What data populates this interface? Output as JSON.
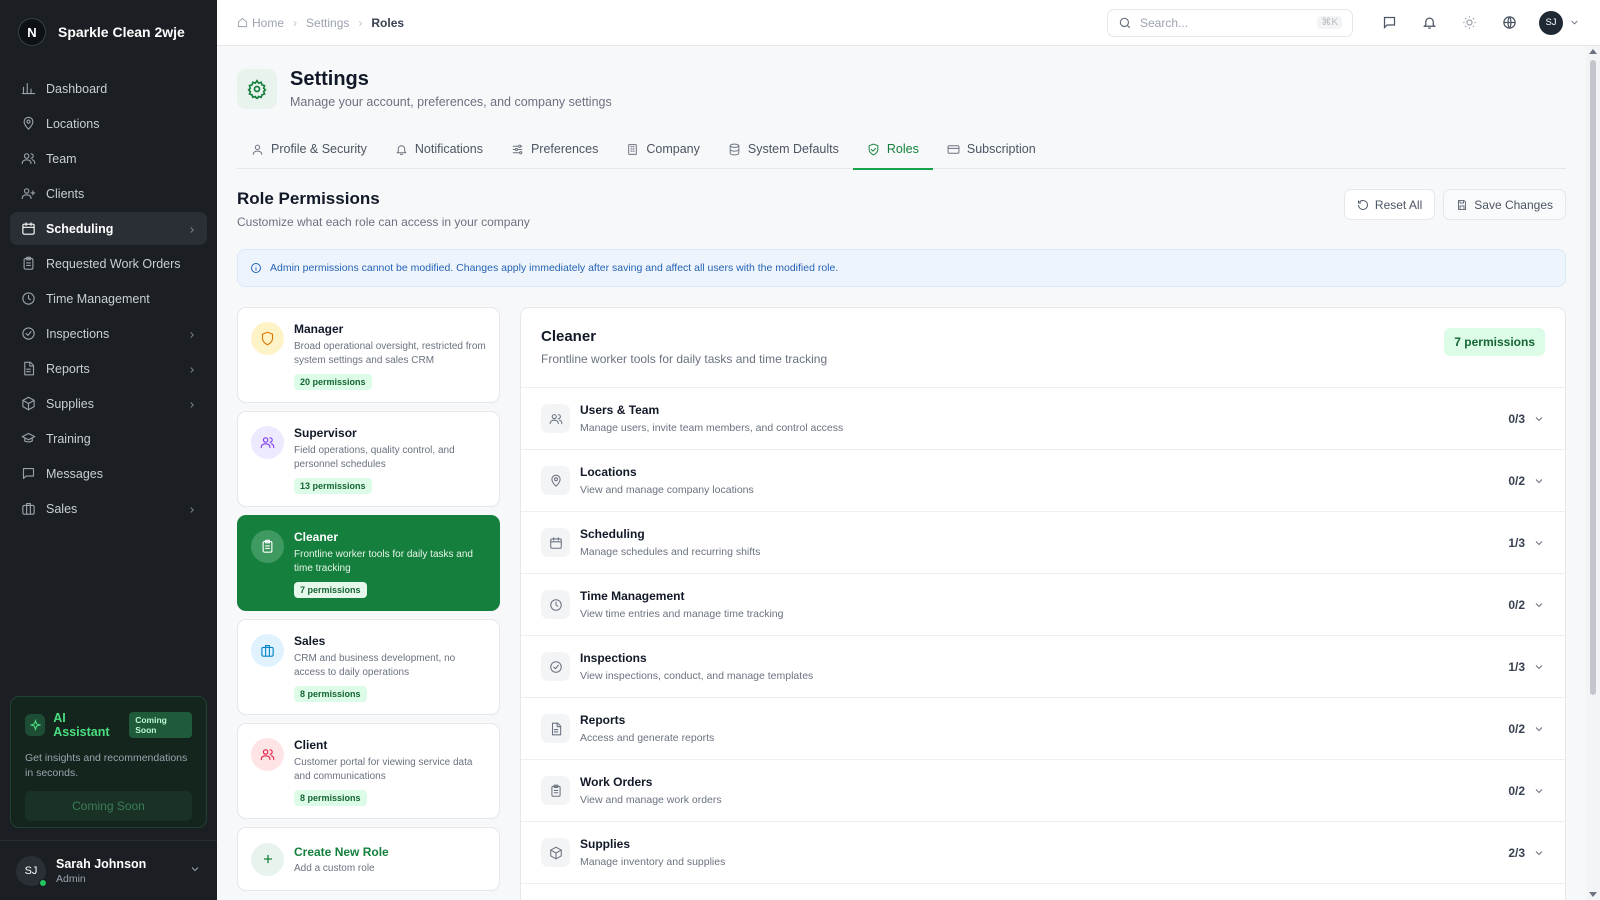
{
  "app": {
    "logo_letter": "N",
    "name": "Sparkle Clean 2wje"
  },
  "sidebar": {
    "items": [
      {
        "label": "Dashboard",
        "icon": "chart-icon"
      },
      {
        "label": "Locations",
        "icon": "map-pin-icon"
      },
      {
        "label": "Team",
        "icon": "users-icon"
      },
      {
        "label": "Clients",
        "icon": "user-plus-icon"
      },
      {
        "label": "Scheduling",
        "icon": "calendar-icon",
        "active": true,
        "chevron": true
      },
      {
        "label": "Requested Work Orders",
        "icon": "clipboard-icon"
      },
      {
        "label": "Time Management",
        "icon": "clock-icon"
      },
      {
        "label": "Inspections",
        "icon": "check-circle-icon",
        "chevron": true
      },
      {
        "label": "Reports",
        "icon": "file-icon",
        "chevron": true
      },
      {
        "label": "Supplies",
        "icon": "box-icon",
        "chevron": true
      },
      {
        "label": "Training",
        "icon": "graduation-cap-icon"
      },
      {
        "label": "Messages",
        "icon": "message-icon"
      },
      {
        "label": "Sales",
        "icon": "briefcase-icon",
        "chevron": true
      }
    ]
  },
  "ai_assistant": {
    "title": "AI Assistant",
    "badge": "Coming Soon",
    "description": "Get insights and recommendations in seconds.",
    "button": "Coming Soon"
  },
  "user": {
    "initials": "SJ",
    "name": "Sarah Johnson",
    "role": "Admin"
  },
  "topbar": {
    "breadcrumbs": [
      "Home",
      "Settings",
      "Roles"
    ],
    "search_placeholder": "Search...",
    "search_shortcut": "⌘K",
    "avatar_initials": "SJ"
  },
  "page": {
    "title": "Settings",
    "subtitle": "Manage your account, preferences, and company settings"
  },
  "tabs": [
    {
      "label": "Profile & Security",
      "icon": "user-icon"
    },
    {
      "label": "Notifications",
      "icon": "bell-icon"
    },
    {
      "label": "Preferences",
      "icon": "sliders-icon"
    },
    {
      "label": "Company",
      "icon": "building-icon"
    },
    {
      "label": "System Defaults",
      "icon": "database-icon"
    },
    {
      "label": "Roles",
      "icon": "shield-check-icon",
      "active": true
    },
    {
      "label": "Subscription",
      "icon": "credit-card-icon"
    }
  ],
  "section": {
    "title": "Role Permissions",
    "subtitle": "Customize what each role can access in your company",
    "reset_label": "Reset All",
    "save_label": "Save Changes"
  },
  "alert": {
    "text": "Admin permissions cannot be modified. Changes apply immediately after saving and affect all users with the modified role."
  },
  "roles": [
    {
      "name": "Manager",
      "description": "Broad operational oversight, restricted from system settings and sales CRM",
      "permissions": "20 permissions",
      "icon": "shield-icon",
      "color": "#d97706",
      "bg": "#fef3c7"
    },
    {
      "name": "Supervisor",
      "description": "Field operations, quality control, and personnel schedules",
      "permissions": "13 permissions",
      "icon": "users-icon",
      "color": "#7c3aed",
      "bg": "#ede9fe"
    },
    {
      "name": "Cleaner",
      "description": "Frontline worker tools for daily tasks and time tracking",
      "permissions": "7 permissions",
      "icon": "clipboard-icon",
      "color": "#ffffff",
      "bg": "#3f9a61",
      "active": true
    },
    {
      "name": "Sales",
      "description": "CRM and business development, no access to daily operations",
      "permissions": "8 permissions",
      "icon": "briefcase-icon",
      "color": "#0284c7",
      "bg": "#e0f2fe"
    },
    {
      "name": "Client",
      "description": "Customer portal for viewing service data and communications",
      "permissions": "8 permissions",
      "icon": "users-icon",
      "color": "#e11d48",
      "bg": "#ffe4e6"
    }
  ],
  "create_role": {
    "title": "Create New Role",
    "subtitle": "Add a custom role"
  },
  "detail": {
    "title": "Cleaner",
    "subtitle": "Frontline worker tools for daily tasks and time tracking",
    "badge": "7 permissions",
    "groups": [
      {
        "name": "Users & Team",
        "description": "Manage users, invite team members, and control access",
        "count": "0/3",
        "icon": "users-icon"
      },
      {
        "name": "Locations",
        "description": "View and manage company locations",
        "count": "0/2",
        "icon": "map-pin-icon"
      },
      {
        "name": "Scheduling",
        "description": "Manage schedules and recurring shifts",
        "count": "1/3",
        "icon": "calendar-icon"
      },
      {
        "name": "Time Management",
        "description": "View time entries and manage time tracking",
        "count": "0/2",
        "icon": "clock-icon"
      },
      {
        "name": "Inspections",
        "description": "View inspections, conduct, and manage templates",
        "count": "1/3",
        "icon": "check-circle-icon"
      },
      {
        "name": "Reports",
        "description": "Access and generate reports",
        "count": "0/2",
        "icon": "file-icon"
      },
      {
        "name": "Work Orders",
        "description": "View and manage work orders",
        "count": "0/2",
        "icon": "clipboard-icon"
      },
      {
        "name": "Supplies",
        "description": "Manage inventory and supplies",
        "count": "2/3",
        "icon": "box-icon"
      }
    ]
  }
}
